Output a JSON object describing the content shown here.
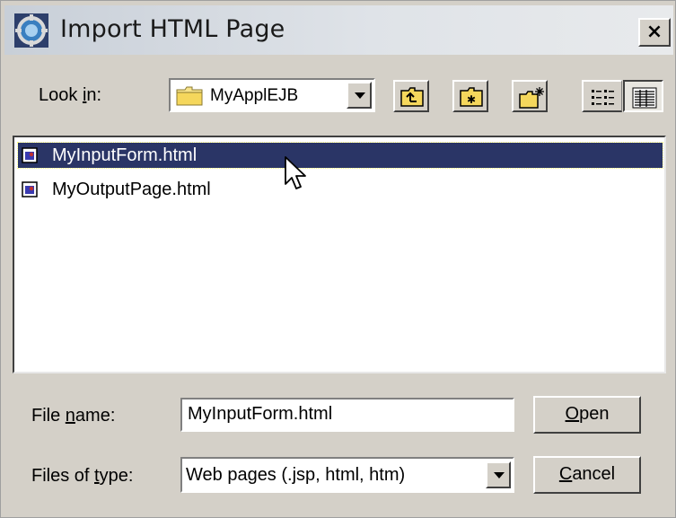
{
  "window": {
    "title": "Import HTML Page",
    "close_label": "×"
  },
  "look_in": {
    "label_before": "Look ",
    "label_mnemonic": "i",
    "label_after": "n:",
    "value": "MyApplEJB"
  },
  "toolbar": {
    "icons": [
      "up-one-level-icon",
      "home-folder-icon",
      "new-folder-icon",
      "list-view-icon",
      "details-view-icon"
    ]
  },
  "files": [
    {
      "name": "MyInputForm.html",
      "icon": "html-file-icon",
      "selected": true
    },
    {
      "name": "MyOutputPage.html",
      "icon": "html-file-icon",
      "selected": false
    }
  ],
  "file_name": {
    "label_before": "File ",
    "label_mnemonic": "n",
    "label_after": "ame:",
    "value": "MyInputForm.html"
  },
  "files_of_type": {
    "label_before": "Files of ",
    "label_mnemonic": "t",
    "label_after": "ype:",
    "value": "Web pages (.jsp, html, htm)"
  },
  "buttons": {
    "open_mnemonic": "O",
    "open_rest": "pen",
    "cancel_mnemonic": "C",
    "cancel_rest": "ancel"
  },
  "colors": {
    "dialog_bg": "#d4d0c8",
    "selection_bg": "#2a3566",
    "title_bar_bg": "#dfe3e8"
  }
}
